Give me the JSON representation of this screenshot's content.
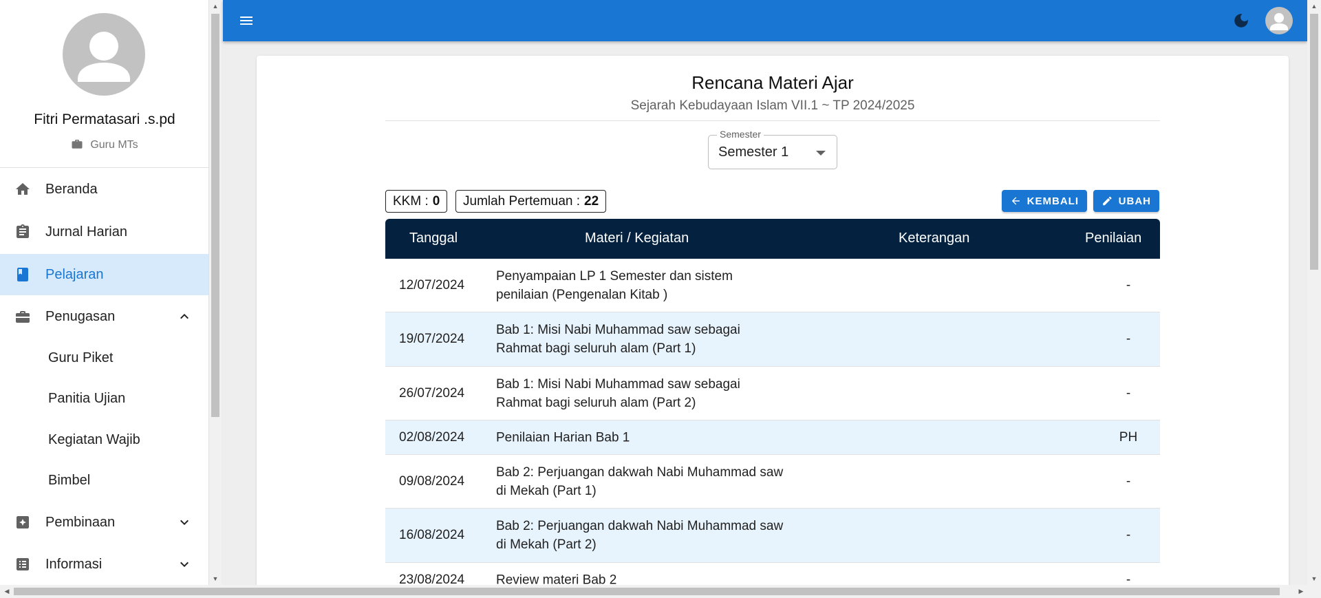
{
  "profile": {
    "name": "Fitri Permatasari .s.pd",
    "role": "Guru MTs"
  },
  "nav": {
    "beranda": "Beranda",
    "jurnal": "Jurnal Harian",
    "pelajaran": "Pelajaran",
    "penugasan": "Penugasan",
    "sub": [
      "Guru Piket",
      "Panitia Ujian",
      "Kegiatan Wajib",
      "Bimbel"
    ],
    "pembinaan": "Pembinaan",
    "informasi": "Informasi"
  },
  "colors": {
    "primary": "#1976d2",
    "header_dark": "#04223f",
    "active_bg": "#d6eafc",
    "alt_row": "#e8f4fd"
  },
  "icons": [
    "menu-icon",
    "moon-icon",
    "account-icon",
    "home-icon",
    "clipboard-icon",
    "book-icon",
    "briefcase-icon",
    "badge-icon",
    "list-icon",
    "arrow-left-icon",
    "pencil-icon",
    "chevron-up-icon",
    "chevron-down-icon"
  ],
  "page": {
    "title": "Rencana Materi Ajar",
    "subtitle": "Sejarah Kebudayaan Islam VII.1 ~ TP 2024/2025"
  },
  "semester": {
    "label": "Semester",
    "value": "Semester 1"
  },
  "stats": {
    "kkm_label": "KKM :",
    "kkm_value": "0",
    "pertemuan_label": "Jumlah Pertemuan :",
    "pertemuan_value": "22"
  },
  "buttons": {
    "kembali": "KEMBALI",
    "ubah": "UBAH"
  },
  "table": {
    "headers": {
      "tanggal": "Tanggal",
      "materi": "Materi / Kegiatan",
      "keterangan": "Keterangan",
      "penilaian": "Penilaian"
    },
    "rows": [
      {
        "tanggal": "12/07/2024",
        "materi": "Penyampaian LP 1 Semester dan sistem penilaian (Pengenalan Kitab )",
        "keterangan": "",
        "penilaian": "-"
      },
      {
        "tanggal": "19/07/2024",
        "materi": "Bab 1: Misi Nabi Muhammad saw sebagai Rahmat bagi seluruh alam (Part 1)",
        "keterangan": "",
        "penilaian": "-"
      },
      {
        "tanggal": "26/07/2024",
        "materi": "Bab 1: Misi Nabi Muhammad saw sebagai Rahmat bagi seluruh alam (Part 2)",
        "keterangan": "",
        "penilaian": "-"
      },
      {
        "tanggal": "02/08/2024",
        "materi": "Penilaian Harian Bab 1",
        "keterangan": "",
        "penilaian": "PH"
      },
      {
        "tanggal": "09/08/2024",
        "materi": "Bab 2: Perjuangan dakwah Nabi Muhammad saw di Mekah (Part 1)",
        "keterangan": "",
        "penilaian": "-"
      },
      {
        "tanggal": "16/08/2024",
        "materi": "Bab 2: Perjuangan dakwah Nabi Muhammad saw di Mekah (Part 2)",
        "keterangan": "",
        "penilaian": "-"
      },
      {
        "tanggal": "23/08/2024",
        "materi": "Review materi Bab 2",
        "keterangan": "",
        "penilaian": "-"
      }
    ]
  }
}
